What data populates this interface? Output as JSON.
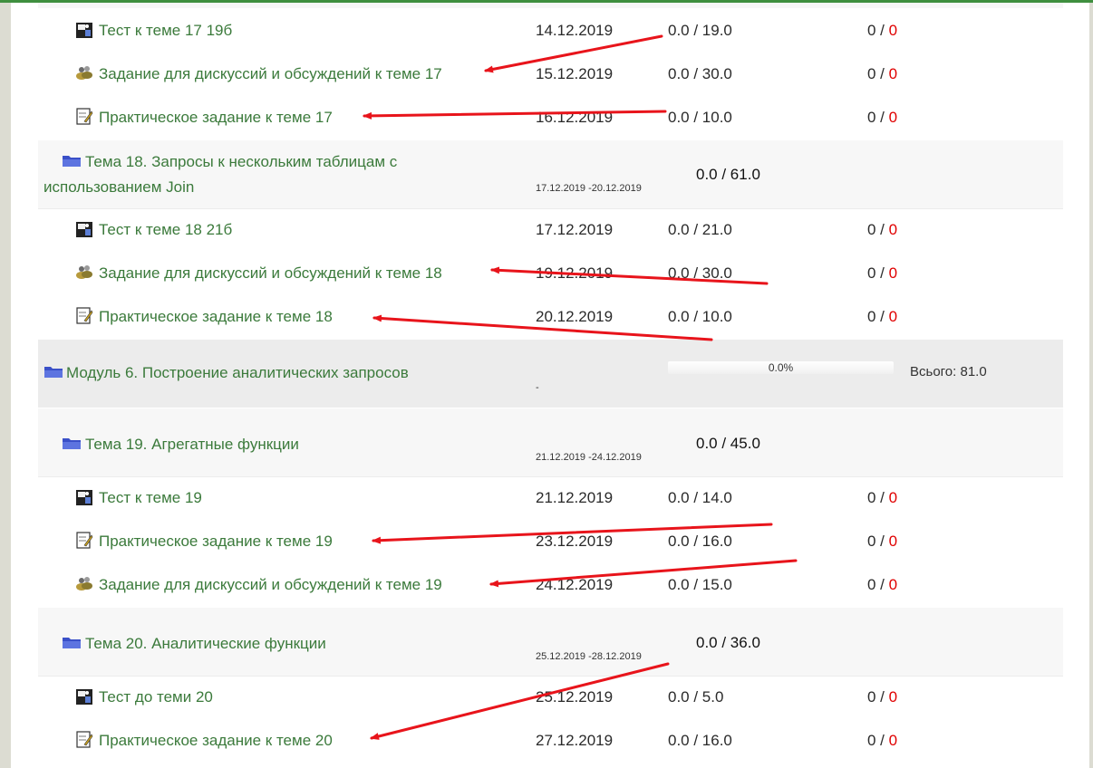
{
  "rows": [
    {
      "kind": "activity",
      "icon": "quiz-icon",
      "title": "Тест к теме 17 19б",
      "date": "14.12.2019",
      "score": "0.0 / 19.0",
      "att_done": "0 / ",
      "att_red": "0"
    },
    {
      "kind": "activity",
      "icon": "forum-icon",
      "title": "Задание для дискуссий и обсуждений к теме 17",
      "date": "15.12.2019",
      "score": "0.0 / 30.0",
      "att_done": "0 / ",
      "att_red": "0"
    },
    {
      "kind": "activity",
      "icon": "assignment-icon",
      "title": "Практическое задание к теме 17",
      "date": "16.12.2019",
      "score": "0.0 / 10.0",
      "att_done": "0 / ",
      "att_red": "0"
    },
    {
      "kind": "topic",
      "icon": "folder-icon",
      "title": "Тема 18. Запросы к нескольким таблицам с использованием Join",
      "range": "17.12.2019 -20.12.2019",
      "total_bold": "0.0",
      "total_rest": " / 61.0"
    },
    {
      "kind": "activity",
      "icon": "quiz-icon",
      "title": "Тест к теме 18 21б",
      "date": "17.12.2019",
      "score": "0.0 / 21.0",
      "att_done": "0 / ",
      "att_red": "0"
    },
    {
      "kind": "activity",
      "icon": "forum-icon",
      "title": "Задание для дискуссий и обсуждений к теме 18",
      "date": "19.12.2019",
      "score": "0.0 / 30.0",
      "att_done": "0 / ",
      "att_red": "0"
    },
    {
      "kind": "activity",
      "icon": "assignment-icon",
      "title": "Практическое задание к теме 18",
      "date": "20.12.2019",
      "score": "0.0 / 10.0",
      "att_done": "0 / ",
      "att_red": "0"
    },
    {
      "kind": "module",
      "icon": "folder-icon",
      "title": "Модуль 6. Построение аналитических запросов",
      "dash": "-",
      "progress_label": "0.0%",
      "progress": 0.0,
      "total": "Всього: 81.0"
    },
    {
      "kind": "topic",
      "icon": "folder-icon",
      "title": "Тема 19. Агрегатные функции",
      "range": "21.12.2019 -24.12.2019",
      "total_bold": "0.0",
      "total_rest": " / 45.0"
    },
    {
      "kind": "activity",
      "icon": "quiz-icon",
      "title": "Тест к теме 19",
      "date": "21.12.2019",
      "score": "0.0 / 14.0",
      "att_done": "0 / ",
      "att_red": "0"
    },
    {
      "kind": "activity",
      "icon": "assignment-icon",
      "title": "Практическое задание к теме 19",
      "date": "23.12.2019",
      "score": "0.0 / 16.0",
      "att_done": "0 / ",
      "att_red": "0"
    },
    {
      "kind": "activity",
      "icon": "forum-icon",
      "title": "Задание для дискуссий и обсуждений к теме 19",
      "date": "24.12.2019",
      "score": "0.0 / 15.0",
      "att_done": "0 / ",
      "att_red": "0"
    },
    {
      "kind": "topic",
      "icon": "folder-icon",
      "title": "Тема 20. Аналитические функции",
      "range": "25.12.2019 -28.12.2019",
      "total_bold": "0.0",
      "total_rest": " / 36.0"
    },
    {
      "kind": "activity",
      "icon": "quiz-icon",
      "title": "Тест до теми 20",
      "date": "25.12.2019",
      "score": "0.0 / 5.0",
      "att_done": "0 / ",
      "att_red": "0"
    },
    {
      "kind": "activity",
      "icon": "assignment-icon",
      "title": "Практическое задание к теме 20",
      "date": "27.12.2019",
      "score": "0.0 / 16.0",
      "att_done": "0 / ",
      "att_red": "0"
    }
  ],
  "colors": {
    "link": "#3b7a3b",
    "attempt_red": "#e00000",
    "arrow_red": "#e8141b",
    "folder_blue": "#3a50c8",
    "top_bar": "#3f8f3f"
  }
}
